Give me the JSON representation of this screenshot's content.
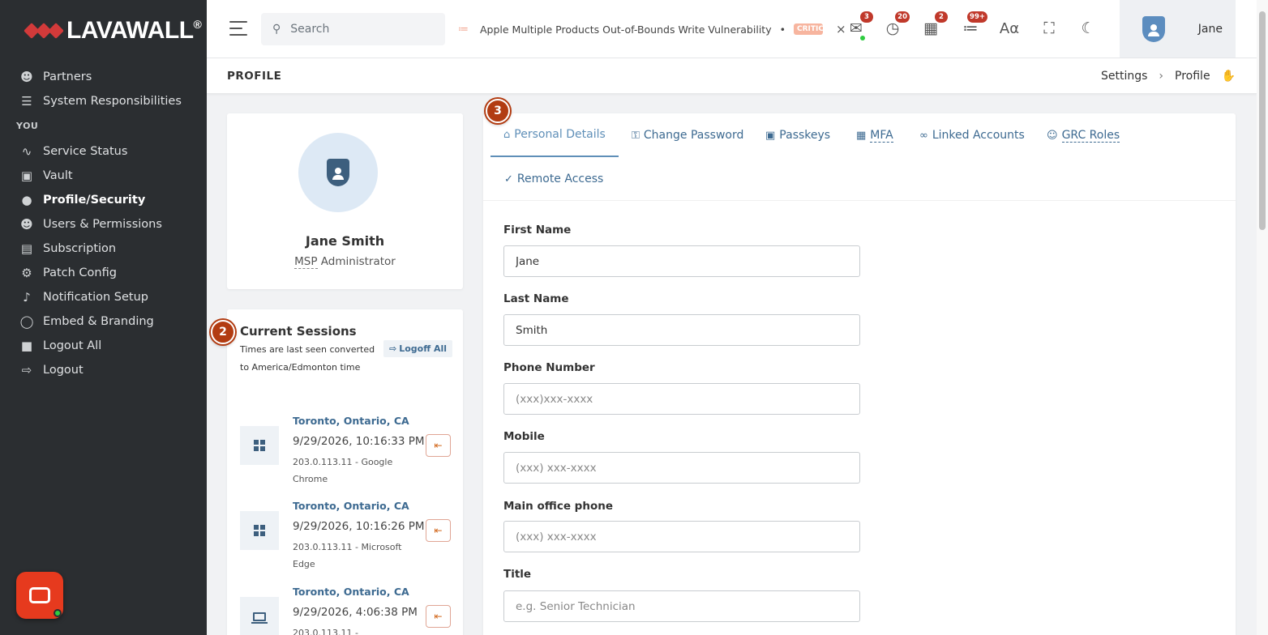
{
  "brand": {
    "name": "LAVAWALL",
    "reg": "®"
  },
  "sidebar": {
    "items_top": [
      {
        "label": "Partners",
        "icon": "partners-icon"
      },
      {
        "label": "System Responsibilities",
        "icon": "list-icon"
      }
    ],
    "section": "YOU",
    "items": [
      {
        "label": "Service Status",
        "icon": "pulse-icon"
      },
      {
        "label": "Vault",
        "icon": "vault-icon"
      },
      {
        "label": "Profile/Security",
        "icon": "user-shield-icon",
        "active": true
      },
      {
        "label": "Users & Permissions",
        "icon": "users-icon"
      },
      {
        "label": "Subscription",
        "icon": "receipt-icon"
      },
      {
        "label": "Patch Config",
        "icon": "cogs-icon"
      },
      {
        "label": "Notification Setup",
        "icon": "bell-gear-icon"
      },
      {
        "label": "Embed & Branding",
        "icon": "globe-icon"
      },
      {
        "label": "Logout All",
        "icon": "lock-icon"
      },
      {
        "label": "Logout",
        "icon": "logout-icon"
      }
    ]
  },
  "header": {
    "search_placeholder": "Search",
    "feed_text": "Apple Multiple Products Out-of-Bounds Write Vulnerability",
    "feed_bullet": "•",
    "feed_badge": "CRITICAL",
    "feed_close": "×",
    "badges": {
      "messages": "3",
      "timers": "20",
      "qr": "2",
      "feeds": "99+"
    },
    "user_name": "Jane"
  },
  "page": {
    "title": "PROFILE",
    "breadcrumb": [
      "Settings",
      "Profile"
    ]
  },
  "profile": {
    "name": "Jane Smith",
    "role_abbr": "MSP",
    "role_rest": " Administrator"
  },
  "sessions": {
    "marker": "2",
    "title": "Current Sessions",
    "note": "Times are last seen converted to America/Edmonton time",
    "logoff_all": "Logoff All",
    "list": [
      {
        "location": "Toronto, Ontario, CA",
        "time": "9/29/2026, 10:16:33 PM",
        "details": "203.0.113.11 - Google Chrome",
        "os": "windows"
      },
      {
        "location": "Toronto, Ontario, CA",
        "time": "9/29/2026, 10:16:26 PM",
        "details": "203.0.113.11 - Microsoft Edge",
        "os": "windows"
      },
      {
        "location": "Toronto, Ontario, CA",
        "time": "9/29/2026, 4:06:38 PM",
        "details": "203.0.113.11 -",
        "os": "laptop"
      }
    ]
  },
  "tabs": {
    "marker": "3",
    "items": [
      {
        "label": "Personal Details",
        "icon": "home-icon"
      },
      {
        "label": "Change Password",
        "icon": "key-icon"
      },
      {
        "label": "Passkeys",
        "icon": "monitor-icon"
      },
      {
        "label": "MFA",
        "icon": "qrcode-icon"
      },
      {
        "label": "Linked Accounts",
        "icon": "link-icon"
      },
      {
        "label": "GRC Roles",
        "icon": "user-tag-icon"
      },
      {
        "label": "Remote Access",
        "icon": "shield-check-icon"
      }
    ]
  },
  "form": {
    "fields": [
      {
        "label": "First Name",
        "value": "Jane",
        "placeholder": ""
      },
      {
        "label": "Last Name",
        "value": "Smith",
        "placeholder": ""
      },
      {
        "label": "Phone Number",
        "value": "",
        "placeholder": "(xxx)xxx-xxxx"
      },
      {
        "label": "Mobile",
        "value": "",
        "placeholder": "(xxx) xxx-xxxx"
      },
      {
        "label": "Main office phone",
        "value": "",
        "placeholder": "(xxx) xxx-xxxx"
      },
      {
        "label": "Title",
        "value": "",
        "placeholder": "e.g. Senior Technician"
      }
    ]
  }
}
